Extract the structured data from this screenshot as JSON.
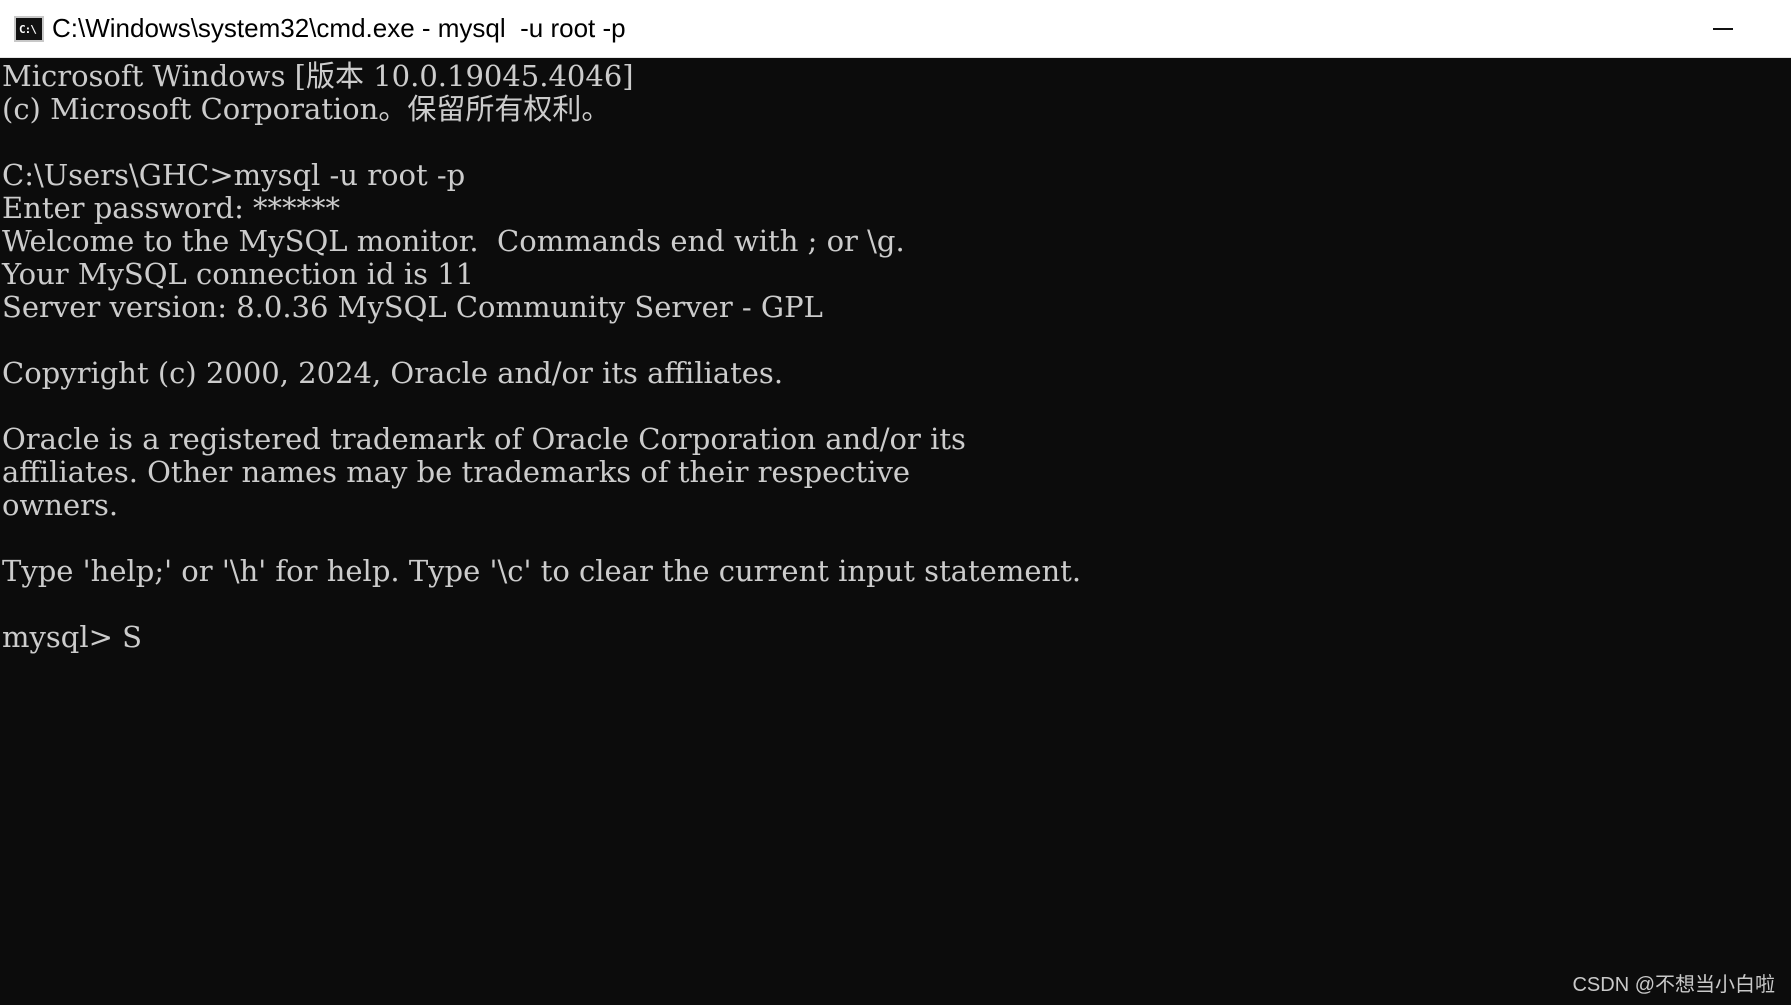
{
  "window": {
    "title": "C:\\Windows\\system32\\cmd.exe - mysql  -u root -p",
    "icon": "cmd-icon",
    "icon_text": "C:\\",
    "minimize_icon": "minimize-icon"
  },
  "console": {
    "lines": [
      "Microsoft Windows [版本 10.0.19045.4046]",
      "(c) Microsoft Corporation。保留所有权利。",
      "",
      "C:\\Users\\GHC>mysql -u root -p",
      "Enter password: ******",
      "Welcome to the MySQL monitor.  Commands end with ; or \\g.",
      "Your MySQL connection id is 11",
      "Server version: 8.0.36 MySQL Community Server - GPL",
      "",
      "Copyright (c) 2000, 2024, Oracle and/or its affiliates.",
      "",
      "Oracle is a registered trademark of Oracle Corporation and/or its",
      "affiliates. Other names may be trademarks of their respective",
      "owners.",
      "",
      "Type 'help;' or '\\h' for help. Type '\\c' to clear the current input statement.",
      ""
    ],
    "prompt": "mysql> ",
    "input": "S"
  },
  "watermark": "CSDN @不想当小白啦",
  "colors": {
    "background": "#0c0c0c",
    "text": "#cccccc",
    "titlebar": "#ffffff"
  }
}
